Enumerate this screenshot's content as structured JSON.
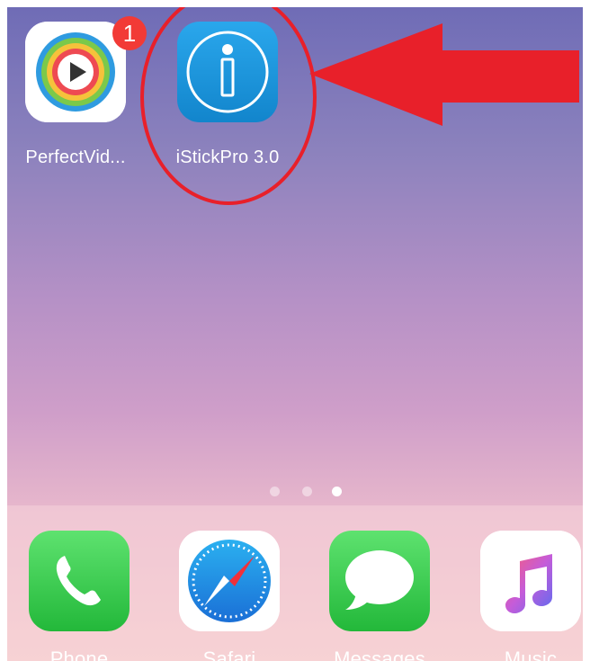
{
  "home_apps": [
    {
      "label": "PerfectVid...",
      "icon": "perfectvideo-icon",
      "badge": "1"
    },
    {
      "label": "iStickPro 3.0",
      "icon": "istickpro-icon"
    }
  ],
  "page_indicator": {
    "count": 3,
    "active": 3
  },
  "dock": [
    {
      "label": "Phone",
      "icon": "phone-icon"
    },
    {
      "label": "Safari",
      "icon": "safari-icon"
    },
    {
      "label": "Messages",
      "icon": "messages-icon"
    },
    {
      "label": "Music",
      "icon": "music-icon"
    }
  ],
  "colors": {
    "annotation": "#e8202a",
    "istick_blue": "#1a8fd8",
    "green": "#39d257"
  }
}
